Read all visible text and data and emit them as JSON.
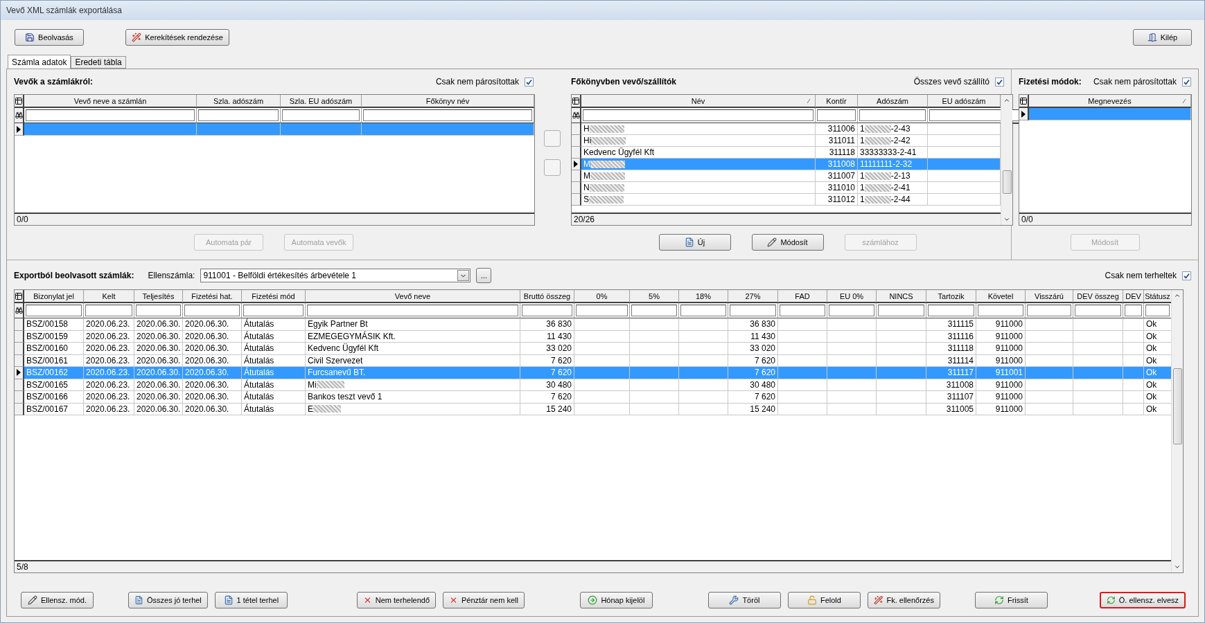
{
  "window": {
    "title": "Vevő XML számlák exportálása"
  },
  "toolbar": {
    "left": [
      {
        "label": "Beolvasás"
      },
      {
        "label": "Kerekítések rendezése"
      }
    ],
    "right": [
      {
        "label": "Kilép"
      }
    ]
  },
  "tabs": [
    {
      "label": "Számla adatok",
      "selected": true
    },
    {
      "label": "Eredeti tábla",
      "selected": false
    }
  ],
  "customers_panel": {
    "title": "Vevők a számlákról:",
    "filter": {
      "label": "Csak nem párosítottak",
      "checked": true
    },
    "columns": [
      {
        "label": "Vevő neve a számlán",
        "sorted": false
      },
      {
        "label": "Szla. adószám",
        "sorted": false
      },
      {
        "label": "Szla. EU adószám",
        "sorted": false
      },
      {
        "label": "Főkönyv név",
        "sorted": false
      }
    ],
    "rows": [
      {
        "selected": true
      }
    ],
    "status": "0/0",
    "buttons": [
      {
        "label": "Automata pár",
        "disabled": true
      },
      {
        "label": "Automata vevők",
        "disabled": true
      }
    ]
  },
  "ledger_panel": {
    "title": "Főkönyvben vevő/szállítók",
    "filter": {
      "label": "Összes vevő szállító",
      "checked": true
    },
    "columns": [
      {
        "label": "Név",
        "sorted": true
      },
      {
        "label": "Kontír",
        "sorted": false
      },
      {
        "label": "Adószám",
        "sorted": false
      },
      {
        "label": "EU adószám",
        "sorted": false
      }
    ],
    "rows": [
      {
        "name": "H",
        "name_blurred": true,
        "kontir": "311006",
        "tax_id": "1",
        "tax_id_tail": "-2-43",
        "selected": false
      },
      {
        "name": "Hi",
        "name_blurred": true,
        "kontir": "311011",
        "tax_id": "1",
        "tax_id_tail": "-2-42",
        "selected": false
      },
      {
        "name": "Kedvenc Ügyfél Kft",
        "name_blurred": false,
        "kontir": "311118",
        "tax_id": "33333333-2-41",
        "tax_id_tail": "",
        "selected": false
      },
      {
        "name": "M",
        "name_blurred": true,
        "kontir": "311008",
        "tax_id": "11111111-2-32",
        "tax_id_tail": "",
        "selected": true
      },
      {
        "name": "M",
        "name_blurred": true,
        "kontir": "311007",
        "tax_id": "1",
        "tax_id_tail": "-2-13",
        "selected": false
      },
      {
        "name": "N",
        "name_blurred": true,
        "kontir": "311010",
        "tax_id": "1",
        "tax_id_tail": "-2-41",
        "selected": false
      },
      {
        "name": "S",
        "name_blurred": true,
        "kontir": "311012",
        "tax_id": "1",
        "tax_id_tail": "-2-44",
        "selected": false
      }
    ],
    "status": "20/26",
    "buttons": [
      {
        "label": "Új",
        "disabled": false
      },
      {
        "label": "Módosít",
        "disabled": false
      },
      {
        "label": "számlához",
        "disabled": true
      }
    ]
  },
  "payment_panel": {
    "title": "Fizetési módok:",
    "filter": {
      "label": "Csak nem párosítottak",
      "checked": true
    },
    "columns": [
      {
        "label": "Megnevezés",
        "sorted": true
      }
    ],
    "rows": [
      {
        "selected": true
      }
    ],
    "status": "0/0",
    "buttons": [
      {
        "label": "Módosít",
        "disabled": true
      }
    ]
  },
  "invoices": {
    "title": "Exportból beolvasott számlák:",
    "account": {
      "label": "Ellenszámla:",
      "value": "911001 - Belföldi értékesítés árbevétele 1",
      "more": "..."
    },
    "filter": {
      "label": "Csak nem terheltek",
      "checked": true
    },
    "columns": [
      {
        "label": "Bizonylat jel"
      },
      {
        "label": "Kelt"
      },
      {
        "label": "Teljesítés"
      },
      {
        "label": "Fizetési hat."
      },
      {
        "label": "Fizetési mód"
      },
      {
        "label": "Vevő neve"
      },
      {
        "label": "Bruttó összeg"
      },
      {
        "label": "0%"
      },
      {
        "label": "5%"
      },
      {
        "label": "18%"
      },
      {
        "label": "27%"
      },
      {
        "label": "FAD"
      },
      {
        "label": "EU 0%"
      },
      {
        "label": "NINCS"
      },
      {
        "label": "Tartozik"
      },
      {
        "label": "Követel"
      },
      {
        "label": "Visszárú"
      },
      {
        "label": "DEV összeg"
      },
      {
        "label": "DEV"
      },
      {
        "label": "Státusz"
      }
    ],
    "rows": [
      {
        "selected": false,
        "name_blurred": false,
        "cells": [
          "BSZ/00158",
          "2020.06.23.",
          "2020.06.30.",
          "2020.06.30.",
          "Átutalás",
          "Egyik Partner Bt",
          "36 830",
          "",
          "",
          "",
          "36 830",
          "",
          "",
          "",
          "311115",
          "911000",
          "",
          "",
          "",
          "Ok"
        ]
      },
      {
        "selected": false,
        "name_blurred": false,
        "cells": [
          "BSZ/00159",
          "2020.06.23.",
          "2020.06.30.",
          "2020.06.30.",
          "Átutalás",
          "EZMEGEGYMÁSIK Kft.",
          "11 430",
          "",
          "",
          "",
          "11 430",
          "",
          "",
          "",
          "311116",
          "911000",
          "",
          "",
          "",
          "Ok"
        ]
      },
      {
        "selected": false,
        "name_blurred": false,
        "cells": [
          "BSZ/00160",
          "2020.06.23.",
          "2020.06.30.",
          "2020.06.30.",
          "Átutalás",
          "Kedvenc Ügyfél Kft",
          "33 020",
          "",
          "",
          "",
          "33 020",
          "",
          "",
          "",
          "311118",
          "911000",
          "",
          "",
          "",
          "Ok"
        ]
      },
      {
        "selected": false,
        "name_blurred": false,
        "cells": [
          "BSZ/00161",
          "2020.06.23.",
          "2020.06.30.",
          "2020.06.30.",
          "Átutalás",
          "Civil Szervezet",
          "7 620",
          "",
          "",
          "",
          "7 620",
          "",
          "",
          "",
          "311114",
          "911000",
          "",
          "",
          "",
          "Ok"
        ]
      },
      {
        "selected": true,
        "name_blurred": false,
        "cells": [
          "BSZ/00162",
          "2020.06.23.",
          "2020.06.30.",
          "2020.06.30.",
          "Átutalás",
          "Furcsanevű BT.",
          "7 620",
          "",
          "",
          "",
          "7 620",
          "",
          "",
          "",
          "311117",
          "911001",
          "",
          "",
          "",
          "Ok"
        ]
      },
      {
        "selected": false,
        "name_blurred": true,
        "cells": [
          "BSZ/00165",
          "2020.06.23.",
          "2020.06.30.",
          "2020.06.30.",
          "Átutalás",
          "Mi",
          "30 480",
          "",
          "",
          "",
          "30 480",
          "",
          "",
          "",
          "311008",
          "911000",
          "",
          "",
          "",
          "Ok"
        ]
      },
      {
        "selected": false,
        "name_blurred": false,
        "cells": [
          "BSZ/00166",
          "2020.06.23.",
          "2020.06.30.",
          "2020.06.30.",
          "Átutalás",
          "Bankos teszt vevő 1",
          "7 620",
          "",
          "",
          "",
          "7 620",
          "",
          "",
          "",
          "311107",
          "911000",
          "",
          "",
          "",
          "Ok"
        ]
      },
      {
        "selected": false,
        "name_blurred": true,
        "cells": [
          "BSZ/00167",
          "2020.06.23.",
          "2020.06.30.",
          "2020.06.30.",
          "Átutalás",
          "E",
          "15 240",
          "",
          "",
          "",
          "15 240",
          "",
          "",
          "",
          "311005",
          "911000",
          "",
          "",
          "",
          "Ok"
        ]
      }
    ],
    "status": "5/8"
  },
  "bottom_buttons": [
    {
      "label": "Ellensz. mód.",
      "highlighted": false
    },
    {
      "label": "Összes jó terhel",
      "highlighted": false
    },
    {
      "label": "1 tétel terhel",
      "highlighted": false
    },
    {
      "label": "Nem terhelendő",
      "highlighted": false
    },
    {
      "label": "Pénztár nem kell",
      "highlighted": false
    },
    {
      "label": "Hónap kijelöl",
      "highlighted": false
    },
    {
      "label": "Töröl",
      "highlighted": false
    },
    {
      "label": "Felold",
      "highlighted": false
    },
    {
      "label": "Fk. ellenőrzés",
      "highlighted": false
    },
    {
      "label": "Frissít",
      "highlighted": false
    },
    {
      "label": "Ö. ellensz. elvesz",
      "highlighted": true
    }
  ]
}
